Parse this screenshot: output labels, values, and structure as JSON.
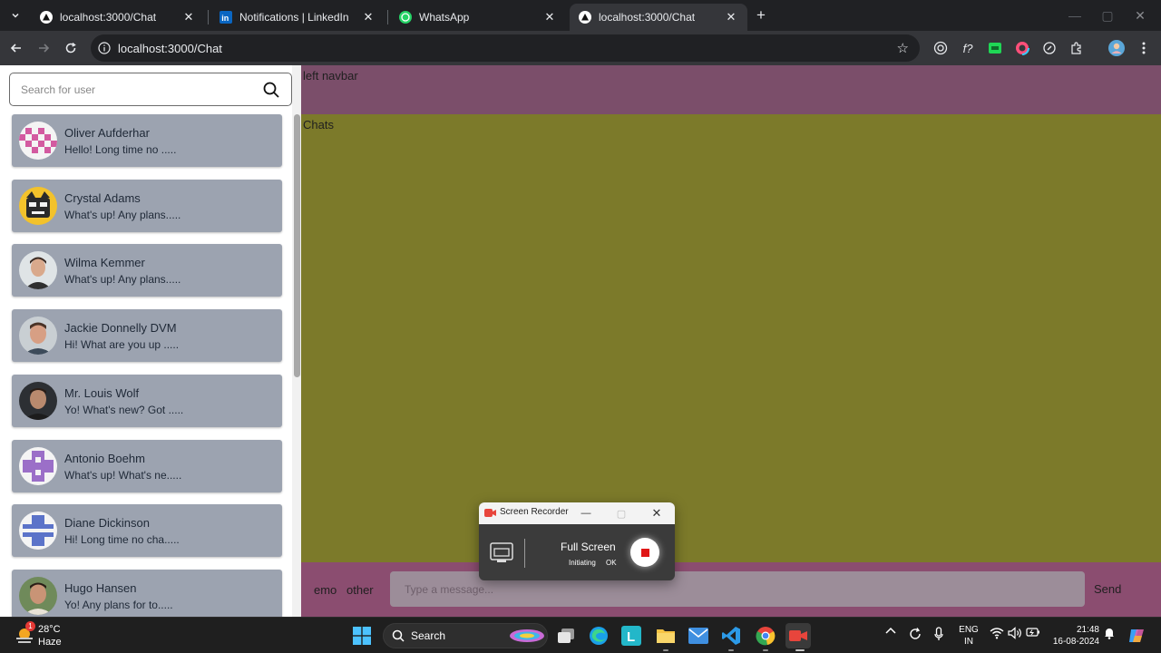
{
  "browser": {
    "tabs": [
      {
        "title": "localhost:3000/Chat",
        "active": false
      },
      {
        "title": "Notifications | LinkedIn",
        "active": false
      },
      {
        "title": "WhatsApp",
        "active": false
      },
      {
        "title": "localhost:3000/Chat",
        "active": true
      }
    ],
    "url": "localhost:3000/Chat"
  },
  "sidebar": {
    "search_placeholder": "Search for user",
    "contacts": [
      {
        "name": "Oliver Aufderhar",
        "preview": "Hello! Long time no ....."
      },
      {
        "name": "Crystal Adams",
        "preview": "What's up! Any plans....."
      },
      {
        "name": "Wilma Kemmer",
        "preview": "What's up! Any plans....."
      },
      {
        "name": "Jackie Donnelly DVM",
        "preview": "Hi! What are you up ....."
      },
      {
        "name": "Mr. Louis Wolf",
        "preview": "Yo! What's new? Got ....."
      },
      {
        "name": "Antonio Boehm",
        "preview": "What's up! What's ne....."
      },
      {
        "name": "Diane Dickinson",
        "preview": "Hi! Long time no cha....."
      },
      {
        "name": "Hugo Hansen",
        "preview": "Yo! Any plans for to....."
      }
    ]
  },
  "main": {
    "navbar_label": "left navbar",
    "chats_label": "Chats",
    "composer": {
      "emo_label": "emo",
      "other_label": "other",
      "input_placeholder": "Type a message...",
      "send_label": "Send"
    }
  },
  "recorder": {
    "title": "Screen Recorder",
    "mode_label": "Full Screen",
    "status": "Initiating",
    "status_suffix": "OK"
  },
  "taskbar": {
    "weather_temp": "28°C",
    "weather_condition": "Haze",
    "weather_badge": "1",
    "search_label": "Search",
    "lang_line1": "ENG",
    "lang_line2": "IN",
    "time": "21:48",
    "date": "16-08-2024"
  },
  "colors": {
    "navbar": "#7b4e6a",
    "chats_area": "#7c7a2a",
    "composer": "#8b4d70",
    "contact_card": "#9ca3b0"
  }
}
